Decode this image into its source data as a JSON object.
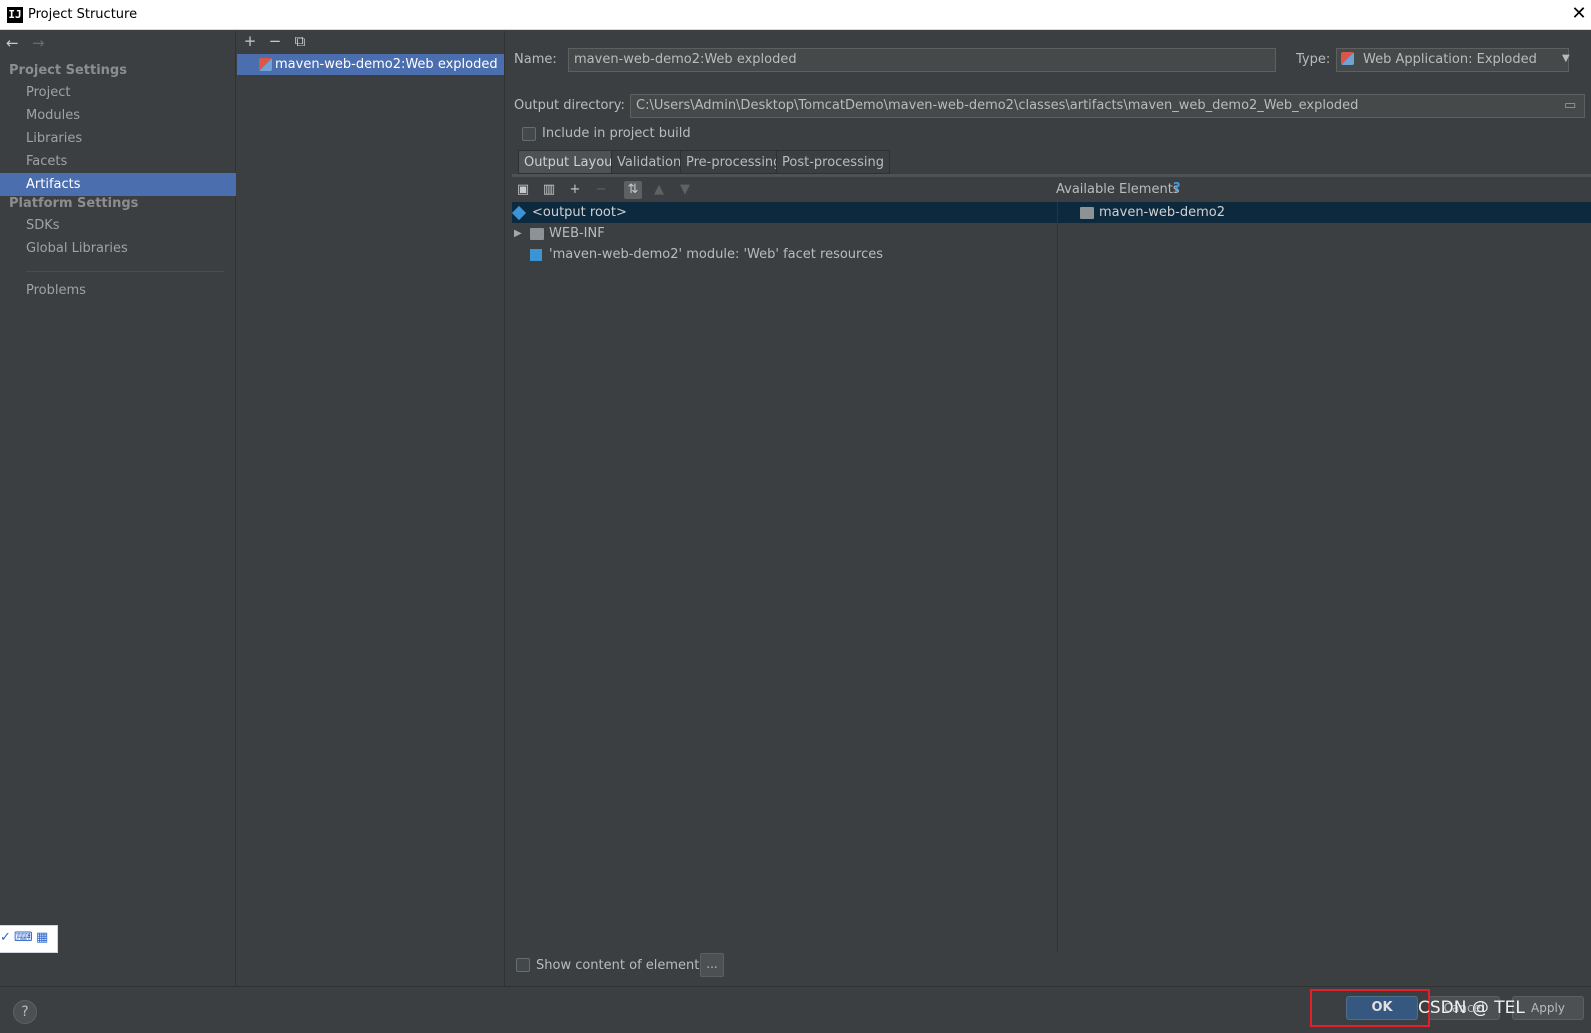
{
  "window": {
    "title": "Project Structure",
    "app_icon": "intellij-icon",
    "close_glyph": "✕"
  },
  "nav": {
    "back_glyph": "←",
    "forward_glyph": "→",
    "sections": [
      {
        "header": "Project Settings",
        "items": [
          "Project",
          "Modules",
          "Libraries",
          "Facets",
          "Artifacts"
        ]
      },
      {
        "header": "Platform Settings",
        "items": [
          "SDKs",
          "Global Libraries"
        ]
      }
    ],
    "selected": "Artifacts",
    "problems": "Problems"
  },
  "artifacts": {
    "toolbar": {
      "add": "+",
      "remove": "−",
      "copy": "⧉"
    },
    "items": [
      "maven-web-demo2:Web exploded"
    ]
  },
  "config": {
    "name_label": "Name:",
    "name_value": "maven-web-demo2:Web exploded",
    "type_label": "Type:",
    "type_value": "Web Application: Exploded",
    "output_label": "Output directory:",
    "output_value": "C:\\Users\\Admin\\Desktop\\TomcatDemo\\maven-web-demo2\\classes\\artifacts\\maven_web_demo2_Web_exploded",
    "include_build_label": "Include in project build",
    "include_build_checked": false
  },
  "tabs": [
    "Output Layout",
    "Validation",
    "Pre-processing",
    "Post-processing"
  ],
  "active_tab": "Output Layout",
  "layout_toolbar": {
    "new_dir": "▣",
    "archive": "▥",
    "add": "+",
    "remove": "−",
    "sort": "⇅",
    "up": "▲",
    "down": "▼"
  },
  "available_elements": {
    "label": "Available Elements",
    "help": "?",
    "items": [
      "maven-web-demo2"
    ]
  },
  "output_tree": [
    {
      "label": "<output root>",
      "icon": "output-root-icon"
    },
    {
      "label": "WEB-INF",
      "icon": "folder-icon"
    },
    {
      "label": "'maven-web-demo2' module: 'Web' facet resources",
      "icon": "web-resource-icon"
    }
  ],
  "bottom": {
    "show_content_label": "Show content of elements",
    "ellipsis": "..."
  },
  "footer": {
    "help": "?",
    "ok": "OK",
    "cancel": "Cancel",
    "apply": "Apply",
    "watermark": "CSDN @ TEL"
  },
  "colors": {
    "background": "#3c3f41",
    "selection": "#4b6eaf",
    "ok_button": "#365880",
    "highlight": "#e3202a"
  }
}
